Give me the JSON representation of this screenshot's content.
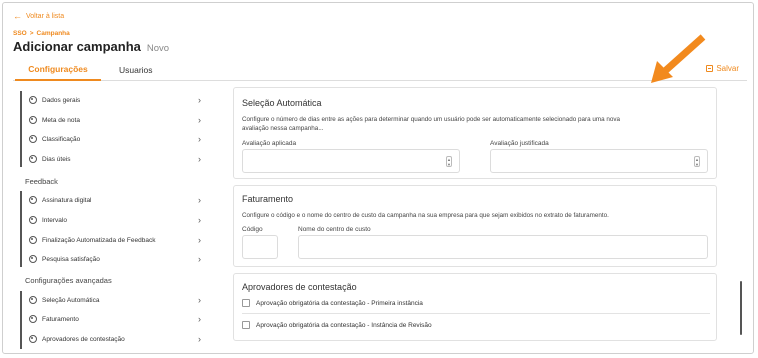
{
  "nav": {
    "back_label": "Voltar à lista"
  },
  "breadcrumb": {
    "root": "SSO",
    "separator": ">",
    "current": "Campanha"
  },
  "header": {
    "title": "Adicionar campanha",
    "subtitle": "Novo"
  },
  "tabs": [
    {
      "label": "Configurações",
      "active": true
    },
    {
      "label": "Usuarios",
      "active": false
    }
  ],
  "toolbar": {
    "save_label": "Salvar"
  },
  "sidebar": {
    "group1": [
      "Dados gerais",
      "Meta de nota",
      "Classificação",
      "Dias úteis"
    ],
    "group2_heading": "Feedback",
    "group2": [
      "Assinatura digital",
      "Intervalo",
      "Finalização Automatizada de Feedback",
      "Pesquisa satisfação"
    ],
    "group3_heading": "Configurações avançadas",
    "group3": [
      "Seleção Automática",
      "Faturamento",
      "Aprovadores de contestação"
    ]
  },
  "selecao": {
    "title": "Seleção Automática",
    "desc_line1": "Configure o número de dias entre as ações para determinar quando um usuário pode ser automaticamente selecionado para uma nova",
    "desc_line2": "avaliação nessa campanha...",
    "field1_label": "Avaliação aplicada",
    "field2_label": "Avaliação justificada",
    "field1_value": "",
    "field2_value": ""
  },
  "faturamento": {
    "title": "Faturamento",
    "desc": "Configure o código e o nome do centro de custo da campanha na sua empresa para que sejam exibidos no extrato de faturamento.",
    "code_label": "Código",
    "name_label": "Nome do centro de custo",
    "code_value": "",
    "name_value": ""
  },
  "aprovadores": {
    "title": "Aprovadores de contestação",
    "option1": "Aprovação obrigatória da contestação - Primeira instância",
    "option2": "Aprovação obrigatória da contestação - Instância de Revisão"
  },
  "colors": {
    "accent": "#ef8a1f",
    "border": "#e1e1e1"
  },
  "icons": {
    "back": "arrow-left-icon",
    "save": "save-icon",
    "settings": "gear-icon",
    "chevron": "chevron-right-icon",
    "annotation": "arrow-annotation"
  }
}
